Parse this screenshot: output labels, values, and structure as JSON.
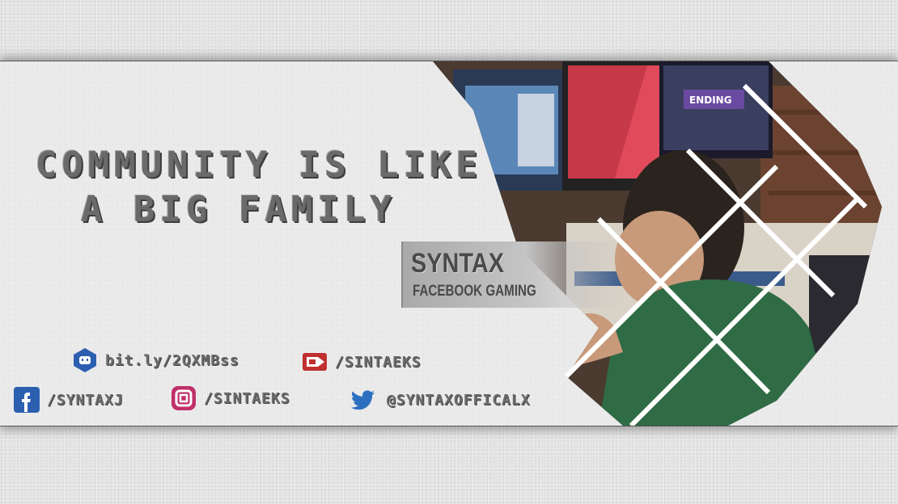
{
  "headline": {
    "line1": "COMMUNITY IS LIKE",
    "line2": "A BIG FAMILY"
  },
  "brand": {
    "name": "SYNTAX",
    "subtitle": "FACEBOOK GAMING"
  },
  "photo_screen_text": "ENDING",
  "socials": [
    {
      "icon": "discord-icon",
      "handle": "bit.ly/2QXMBss",
      "color": "#2c5fb0"
    },
    {
      "icon": "streaming-icon",
      "handle": "/SINTAEKS",
      "color": "#c03030"
    },
    {
      "icon": "facebook-icon",
      "handle": "/SYNTAXJ",
      "color": "#2c5fb0"
    },
    {
      "icon": "instagram-icon",
      "handle": "/SINTAEKS",
      "color": "#c0306a"
    },
    {
      "icon": "twitter-icon",
      "handle": "@SYNTAXOFFICALX",
      "color": "#2c6fc0"
    }
  ],
  "colors": {
    "background": "#e4e4e4",
    "banner": "#ededed",
    "text_gray": "#6a6a6a",
    "shirt_green": "#2f6b45"
  }
}
